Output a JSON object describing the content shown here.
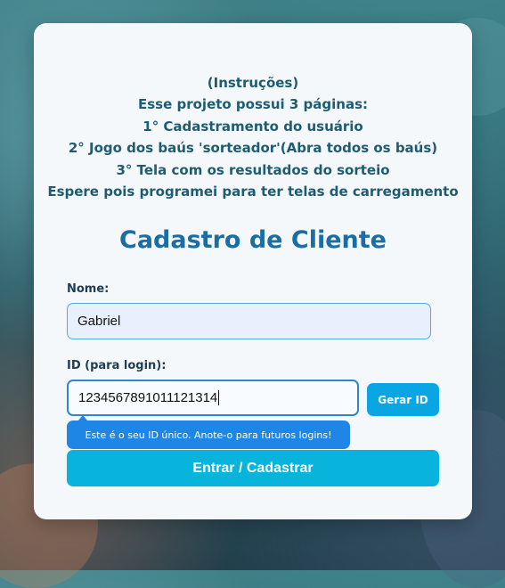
{
  "instructions": {
    "lines": [
      "(Instruções)",
      "Esse projeto possui 3 páginas:",
      "1° Cadastramento do usuário",
      "2° Jogo dos baús 'sorteador'(Abra todos os baús)",
      "3° Tela com os resultados do sorteio",
      "Espere pois programei para ter telas de carregamento"
    ]
  },
  "form": {
    "title": "Cadastro de Cliente",
    "name_label": "Nome:",
    "name_value": "Gabriel",
    "id_label": "ID (para login):",
    "id_value": "123456789101112131‌4",
    "generate_button": "Gerar ID",
    "tooltip": "Este é o seu ID único. Anote-o para futuros logins!",
    "submit_button": "Entrar / Cadastrar"
  },
  "colors": {
    "instructions_text": "#1e5c72",
    "title_text": "#1b6ea3",
    "generate_button_bg": "#0aa6e3",
    "tooltip_bg": "#1f86e6",
    "submit_button_bg": "#08b4dc",
    "card_bg": "#f5f8fb"
  }
}
